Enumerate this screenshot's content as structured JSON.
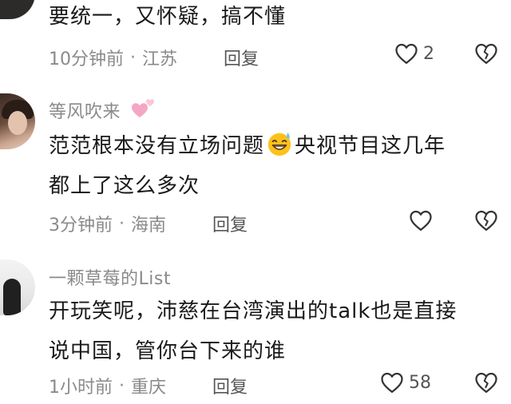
{
  "comments": [
    {
      "username": "",
      "content_lines": [
        "要统一，又怀疑，搞不懂"
      ],
      "time": "10分钟前",
      "separator": "·",
      "location": "江苏",
      "reply_label": "回复",
      "like_count": "2"
    },
    {
      "username": "等风吹来",
      "content_before_emoji": "范范根本没有立场问题",
      "content_after_emoji": "央视节目这几年",
      "content_line2": "都上了这么多次",
      "time": "3分钟前",
      "separator": "·",
      "location": "海南",
      "reply_label": "回复",
      "like_count": ""
    },
    {
      "username": "一颗草莓的List",
      "content_lines": [
        "开玩笑呢，沛慈在台湾演出的talk也是直接",
        "说中国，管你台下来的谁"
      ],
      "time": "1小时前",
      "separator": "·",
      "location": "重庆",
      "reply_label": "回复",
      "like_count": "58"
    }
  ],
  "icons": {
    "like": "heart-outline-icon",
    "dislike": "broken-heart-icon",
    "emoji": "sweat-smile-emoji",
    "username_badge": "pink-hearts-icon"
  },
  "colors": {
    "text": "#1a1a1a",
    "muted": "#8a8a8a",
    "icon": "#333333",
    "badge_pink": "#f4a7c4"
  }
}
